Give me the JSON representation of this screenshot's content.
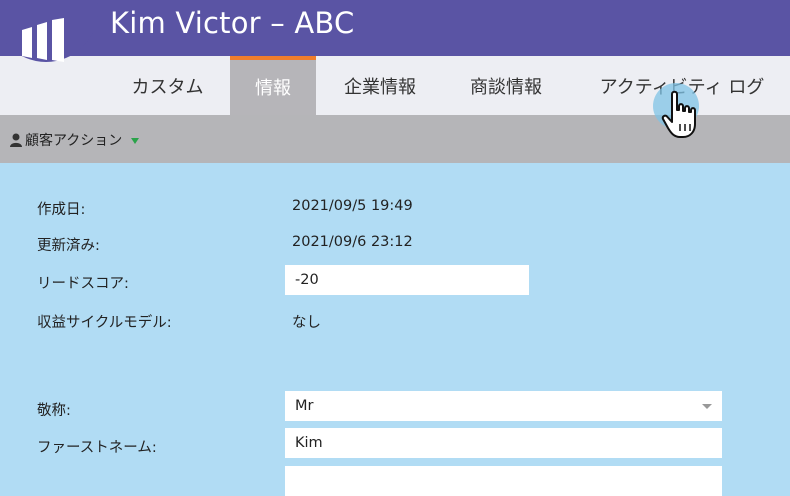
{
  "header": {
    "title": "Kim Victor – ABC",
    "brand_color": "#5a54a4"
  },
  "tabs": [
    {
      "label": "カスタム",
      "active": false
    },
    {
      "label": "情報",
      "active": true
    },
    {
      "label": "企業情報",
      "active": false
    },
    {
      "label": "商談情報",
      "active": false
    },
    {
      "label": "アクティビティ ログ",
      "active": false
    }
  ],
  "action_bar": {
    "label": "顧客アクション"
  },
  "fields": {
    "created": {
      "label": "作成日:",
      "value": "2021/09/5 19:49"
    },
    "updated": {
      "label": "更新済み:",
      "value": "2021/09/6 23:12"
    },
    "lead_score": {
      "label": "リードスコア:",
      "value": "-20"
    },
    "revenue_model": {
      "label": "収益サイクルモデル:",
      "value": "なし"
    },
    "salutation": {
      "label": "敬称:",
      "value": "Mr"
    },
    "first_name": {
      "label": "ファーストネーム:",
      "value": "Kim"
    }
  },
  "icons": {
    "user": "person-icon",
    "dropdown": "triangle-down-icon",
    "cursor": "hand-pointer-icon"
  }
}
